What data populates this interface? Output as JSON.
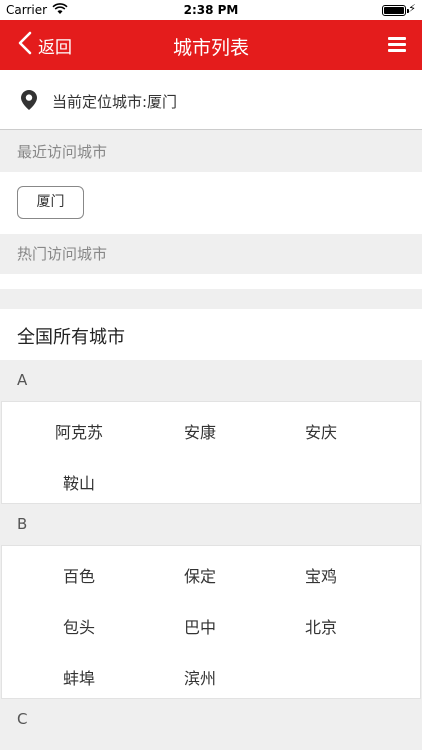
{
  "status_bar": {
    "carrier": "Carrier",
    "time": "2:38 PM"
  },
  "nav": {
    "back_label": "返回",
    "title": "城市列表"
  },
  "location": {
    "text": "当前定位城市:厦门"
  },
  "recent": {
    "header": "最近访问城市",
    "cities": [
      "厦门"
    ]
  },
  "hot": {
    "header": "热门访问城市"
  },
  "all_cities": {
    "label": "全国所有城市"
  },
  "groups": [
    {
      "letter": "A",
      "cities": [
        "阿克苏",
        "安康",
        "安庆",
        "鞍山"
      ]
    },
    {
      "letter": "B",
      "cities": [
        "百色",
        "保定",
        "宝鸡",
        "包头",
        "巴中",
        "北京",
        "蚌埠",
        "滨州"
      ]
    },
    {
      "letter": "C",
      "cities": []
    }
  ],
  "colors": {
    "nav_bg": "#e41c1c",
    "section_bg": "#efefef"
  },
  "icons": {
    "location": "map-pin-icon",
    "back": "chevron-left-icon",
    "menu": "hamburger-menu-icon",
    "wifi": "wifi-icon",
    "battery": "battery-icon"
  }
}
